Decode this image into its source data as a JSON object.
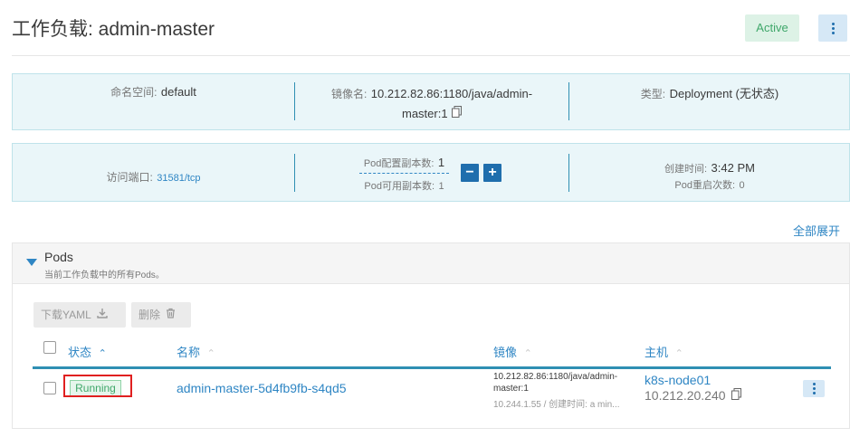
{
  "header": {
    "title": "工作负载: admin-master",
    "status": "Active"
  },
  "info1": {
    "namespace_label": "命名空间:",
    "namespace_value": "default",
    "image_label": "镜像名:",
    "image_value_line1": "10.212.82.86:1180/java/admin-",
    "image_value_line2": "master:1",
    "type_label": "类型:",
    "type_value": "Deployment (无状态)"
  },
  "info2": {
    "port_label": "访问端口:",
    "port_value": "31581/tcp",
    "replicas_label": "Pod配置副本数:",
    "replicas_value": "1",
    "available_label": "Pod可用副本数:",
    "available_value": "1",
    "created_label": "创建时间:",
    "created_value": "3:42 PM",
    "restarts_label": "Pod重启次数:",
    "restarts_value": "0",
    "minus": "−",
    "plus": "+"
  },
  "toggle_all": "全部展开",
  "pods": {
    "title": "Pods",
    "subtitle": "当前工作负载中的所有Pods。",
    "download_label": "下载YAML",
    "delete_label": "删除",
    "columns": {
      "status": "状态",
      "name": "名称",
      "image": "镜像",
      "host": "主机"
    },
    "row": {
      "status": "Running",
      "name": "admin-master-5d4fb9fb-s4qd5",
      "image_line1": "10.212.82.86:1180/java/admin-",
      "image_line2": "master:1",
      "image_sub": "10.244.1.55 / 创建时间: a min...",
      "host": "k8s-node01",
      "host_ip": "10.212.20.240"
    }
  },
  "colors": {
    "accent": "#2f86c4",
    "primary_button": "#1f6ead",
    "active_bg": "#ddf2e6",
    "active_text": "#3fa76a",
    "highlight": "#e02020"
  }
}
